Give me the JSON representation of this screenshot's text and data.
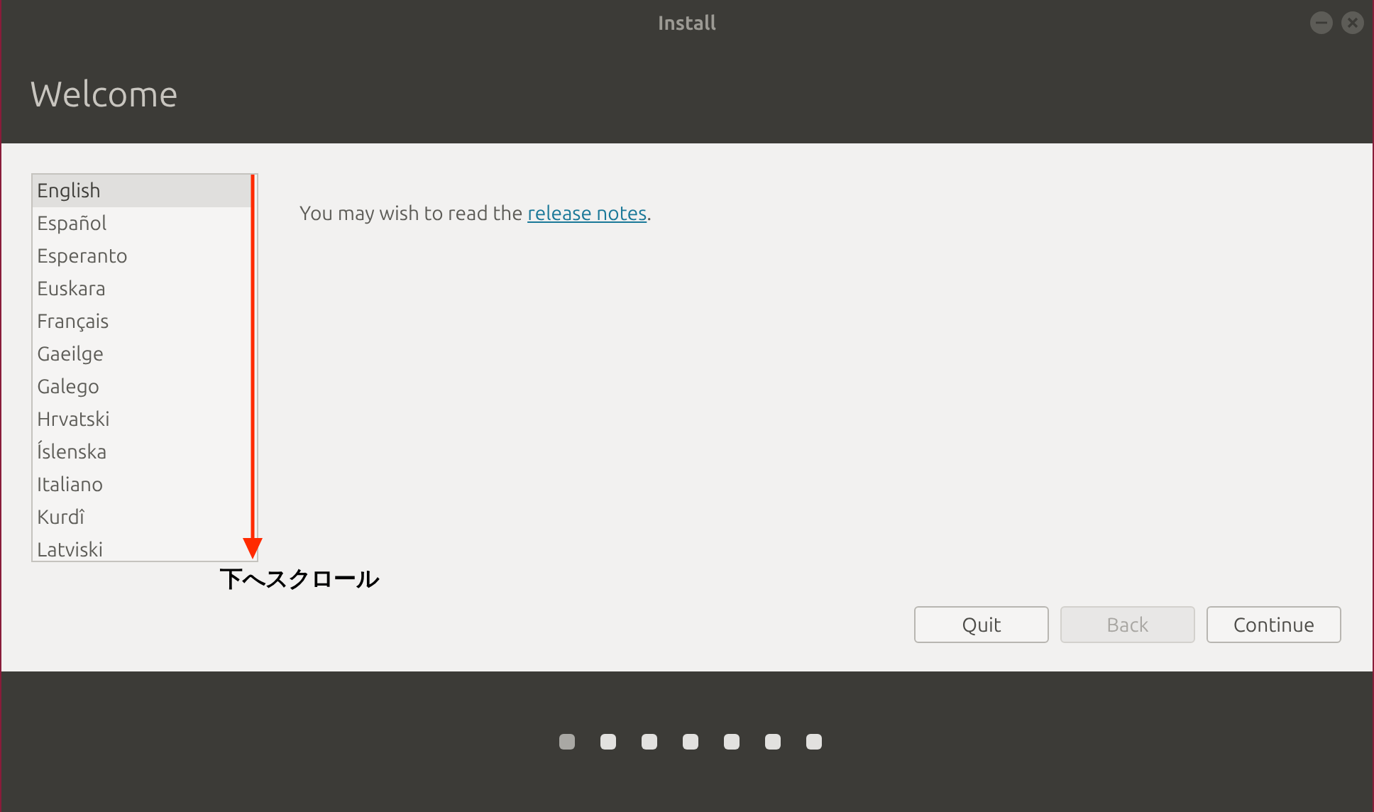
{
  "window": {
    "title": "Install"
  },
  "header": {
    "title": "Welcome"
  },
  "languages": [
    {
      "label": "English",
      "selected": true
    },
    {
      "label": "Español",
      "selected": false
    },
    {
      "label": "Esperanto",
      "selected": false
    },
    {
      "label": "Euskara",
      "selected": false
    },
    {
      "label": "Français",
      "selected": false
    },
    {
      "label": "Gaeilge",
      "selected": false
    },
    {
      "label": "Galego",
      "selected": false
    },
    {
      "label": "Hrvatski",
      "selected": false
    },
    {
      "label": "Íslenska",
      "selected": false
    },
    {
      "label": "Italiano",
      "selected": false
    },
    {
      "label": "Kurdî",
      "selected": false
    },
    {
      "label": "Latviski",
      "selected": false
    }
  ],
  "message": {
    "before": "You may wish to read the ",
    "link": "release notes",
    "after": "."
  },
  "annotation": {
    "text": "下へスクロール"
  },
  "buttons": [
    {
      "label": "Quit",
      "disabled": false
    },
    {
      "label": "Back",
      "disabled": true
    },
    {
      "label": "Continue",
      "disabled": false
    }
  ],
  "progress_dots": [
    {
      "selected": true
    },
    {
      "selected": false
    },
    {
      "selected": false
    },
    {
      "selected": false
    },
    {
      "selected": false
    },
    {
      "selected": false
    },
    {
      "selected": false
    }
  ]
}
